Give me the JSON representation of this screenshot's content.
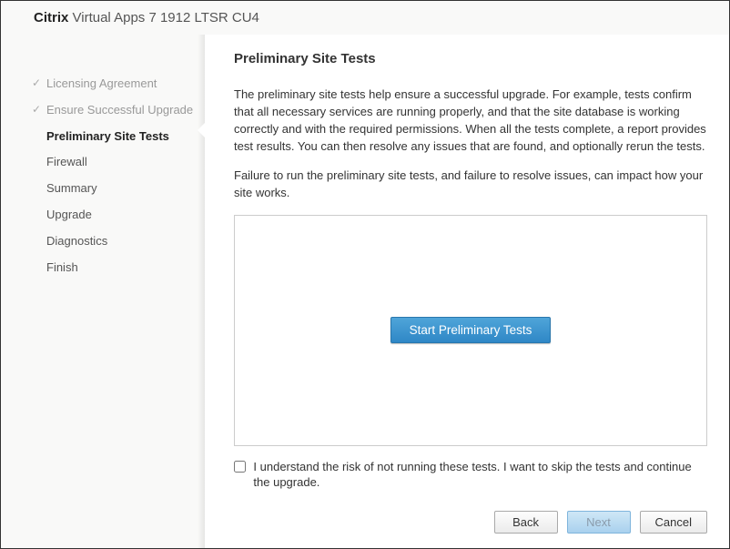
{
  "header": {
    "brand": "Citrix",
    "product": " Virtual Apps 7 1912 LTSR CU4"
  },
  "sidebar": {
    "items": [
      {
        "label": "Licensing Agreement",
        "state": "done"
      },
      {
        "label": "Ensure Successful Upgrade",
        "state": "done"
      },
      {
        "label": "Preliminary Site Tests",
        "state": "current"
      },
      {
        "label": "Firewall",
        "state": "pending"
      },
      {
        "label": "Summary",
        "state": "pending"
      },
      {
        "label": "Upgrade",
        "state": "pending"
      },
      {
        "label": "Diagnostics",
        "state": "pending"
      },
      {
        "label": "Finish",
        "state": "pending"
      }
    ]
  },
  "main": {
    "title": "Preliminary Site Tests",
    "paragraph1": "The preliminary site tests help ensure a successful upgrade. For example, tests confirm that all necessary services are running properly, and that the site database is working correctly and with the required permissions. When all the tests complete, a report provides test results. You can then resolve any issues that are found, and optionally rerun the tests.",
    "paragraph2": "Failure to run the preliminary site tests, and failure to resolve issues, can impact how your site works.",
    "start_button": "Start Preliminary Tests",
    "skip_checkbox_label": "I understand the risk of not running these tests. I want to skip the tests and continue the upgrade."
  },
  "footer": {
    "back": "Back",
    "next": "Next",
    "cancel": "Cancel"
  }
}
